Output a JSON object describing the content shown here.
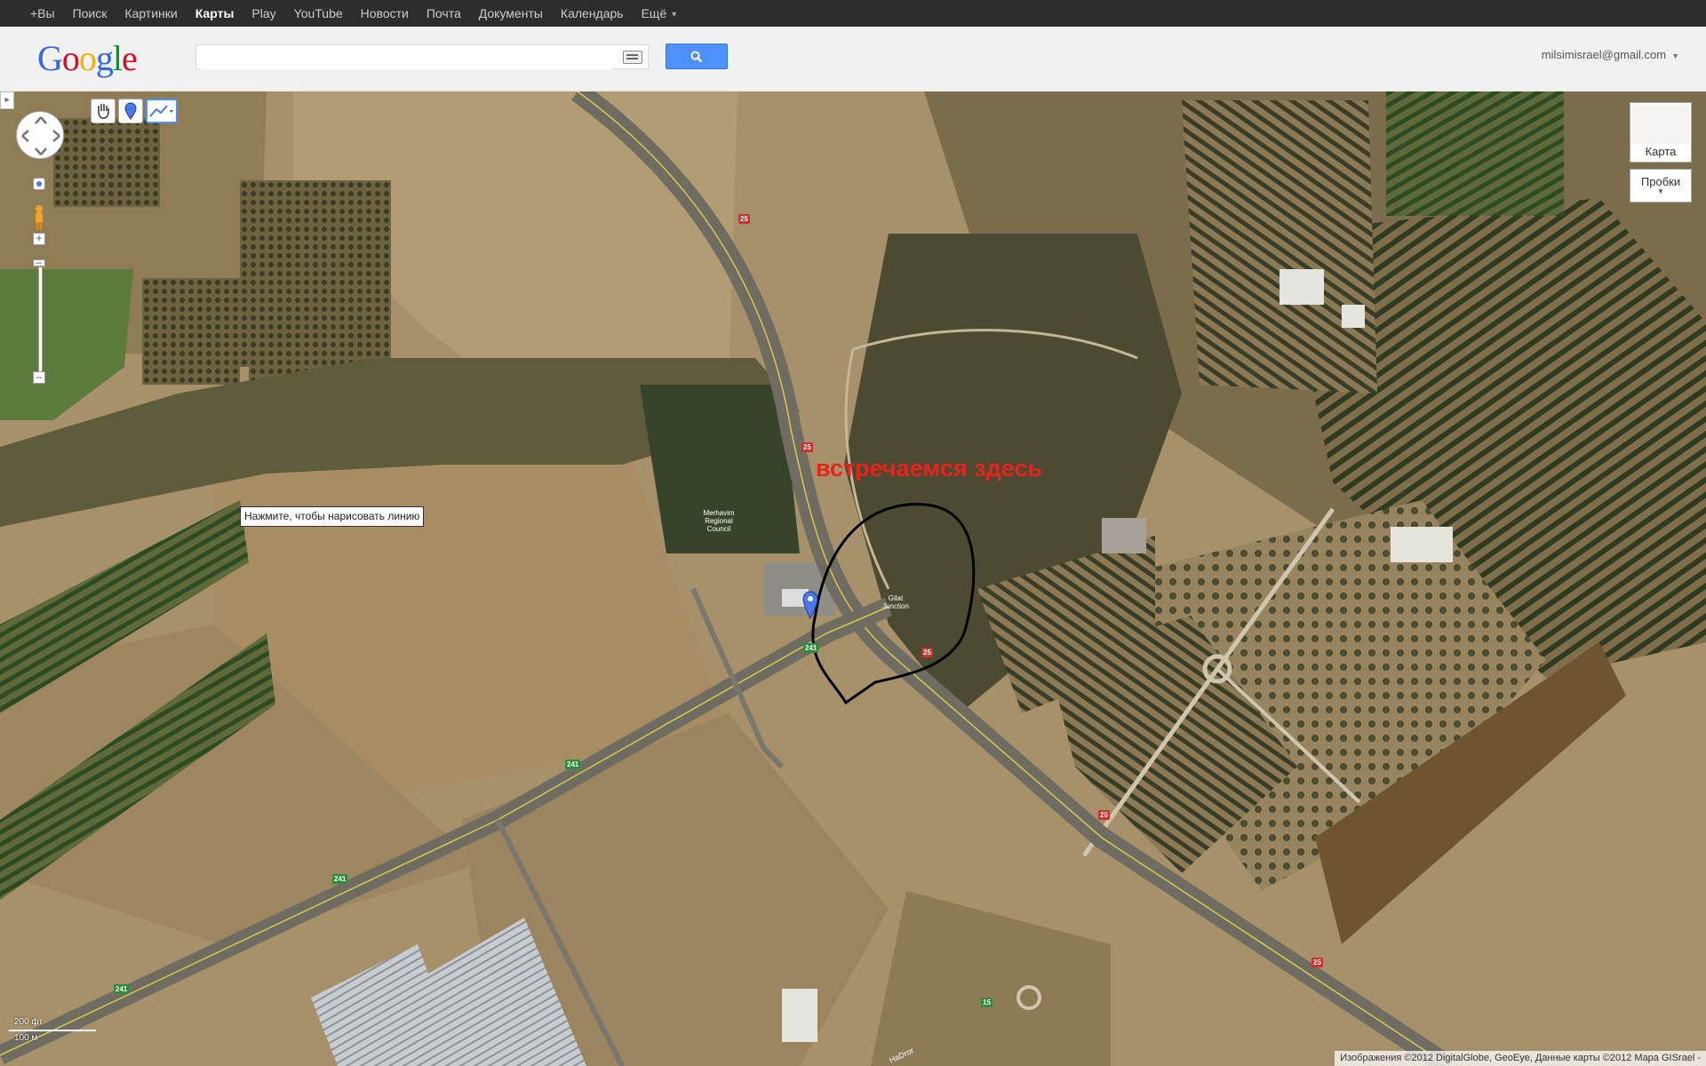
{
  "topnav": {
    "items": [
      "+Вы",
      "Поиск",
      "Картинки",
      "Карты",
      "Play",
      "YouTube",
      "Новости",
      "Почта",
      "Документы",
      "Календарь",
      "Ещё"
    ],
    "active_index": 3
  },
  "header": {
    "logo_text": "Google",
    "search_value": "",
    "account": "milsimisrael@gmail.com"
  },
  "map": {
    "map_type_label": "Карта",
    "traffic_label": "Пробки",
    "tooltip": "Нажмите, чтобы нарисовать линию",
    "annotation": "встречаемся здесь",
    "scale": {
      "top": "200 фт",
      "bottom": "100 м"
    },
    "copyright": "Изображения ©2012 DigitalGlobe, GeoEye, Данные карты ©2012 Mapa GISrael -",
    "place_label_1": "Merhavim Regional Council",
    "place_label_2": "Gilat Junction",
    "street_label": "HaDror",
    "roads": {
      "r25": "25",
      "r241": "241",
      "r15": "15"
    }
  }
}
